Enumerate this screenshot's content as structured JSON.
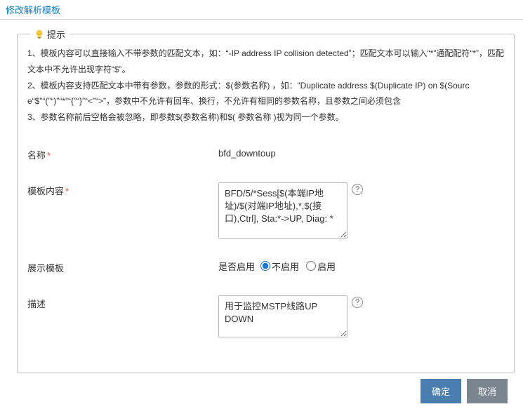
{
  "header": {
    "title": "修改解析模板"
  },
  "tips": {
    "legend": "提示",
    "lines": [
      "1、模板内容可以直接输入不带参数的匹配文本，如：“-IP address IP collision detected”；匹配文本可以输入“*”通配配符“*”，匹配文本中不允许出现字符“$”。",
      "2、模板内容支持匹配文本中带有参数，参数的形式：$(参数名称) ，如：“Duplicate address $(Duplicate IP) on $(Source“$”“(”“)”“*”“{”“}”“<”“>”，参数中不允许有回车、换行，不允许有相同的参数名称，且参数之间必须包含",
      "3、参数名称前后空格会被忽略，即参数$(参数名称)和$( 参数名称 )视为同一个参数。"
    ]
  },
  "form": {
    "name": {
      "label": "名称",
      "value": "bfd_downtoup"
    },
    "template_content": {
      "label": "模板内容",
      "value": "BFD/5/*Sess[$(本端IP地址)/$(对端IP地址),*,$(接口),Ctrl], Sta:*->UP, Diag: *"
    },
    "display_template": {
      "label": "展示模板",
      "enable_label": "是否启用",
      "options": {
        "disable": "不启用",
        "enable": "启用"
      },
      "selected": "disable"
    },
    "description": {
      "label": "描述",
      "value": "用于监控MSTP线路UP DOWN"
    }
  },
  "buttons": {
    "ok": "确定",
    "cancel": "取消"
  }
}
